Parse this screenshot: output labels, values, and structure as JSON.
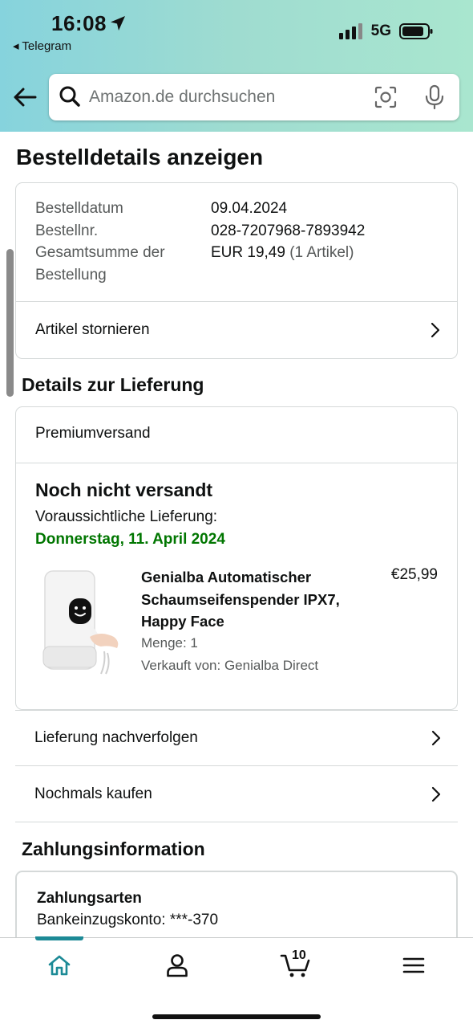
{
  "status_bar": {
    "time": "16:08",
    "back_app": "◂ Telegram",
    "network": "5G"
  },
  "search": {
    "placeholder": "Amazon.de durchsuchen"
  },
  "page_title": "Bestelldetails anzeigen",
  "order_summary": {
    "labels": [
      "Bestelldatum",
      "Bestellnr.",
      "Gesamtsumme der",
      "Bestellung"
    ],
    "date": "09.04.2024",
    "order_number": "028-7207968-7893942",
    "total": "EUR 19,49",
    "item_count": "(1 Artikel)",
    "cancel_label": "Artikel stornieren"
  },
  "delivery": {
    "section_title": "Details zur Lieferung",
    "shipping_type": "Premiumversand",
    "status": "Noch nicht versandt",
    "eta_label": "Voraussichtliche Lieferung:",
    "eta_date": "Donnerstag, 11. April 2024",
    "product": {
      "name": "Genialba Automatischer Schaumseifenspender IPX7, Happy Face",
      "price": "€25,99",
      "quantity": "Menge: 1",
      "seller": "Verkauft von: Genialba Direct"
    },
    "track_label": "Lieferung nachverfolgen",
    "buy_again_label": "Nochmals kaufen"
  },
  "payment": {
    "section_title": "Zahlungsinformation",
    "methods_title": "Zahlungsarten",
    "account": "Bankeinzugskonto: ***-370"
  },
  "bottom_nav": {
    "cart_count": "10",
    "accent_color": "#1c8a96"
  }
}
